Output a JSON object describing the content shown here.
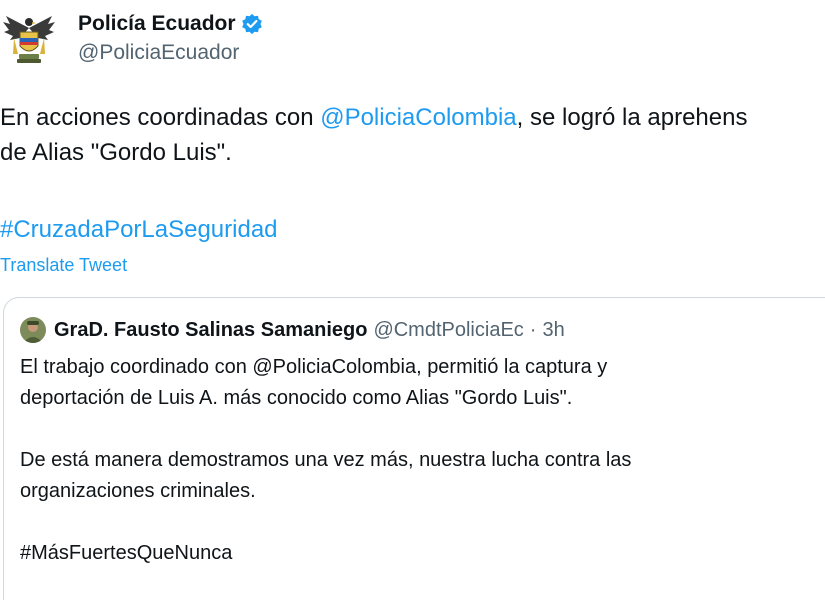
{
  "author": {
    "display_name": "Policía Ecuador",
    "handle": "@PoliciaEcuador",
    "verified_icon": "verified-badge-icon",
    "avatar_icon": "police-eagle-emblem"
  },
  "tweet": {
    "line1_prefix": "En acciones coordinadas con ",
    "line1_mention": "@PoliciaColombia",
    "line1_suffix": ", se logró la aprehens",
    "line2": "de Alias \"Gordo Luis\".",
    "hashtag": "#CruzadaPorLaSeguridad",
    "translate_label": "Translate Tweet"
  },
  "quoted": {
    "name": "GraD. Fausto Salinas Samaniego",
    "handle": "@CmdtPoliciaEc",
    "separator": "·",
    "time": "3h",
    "lines": [
      "El trabajo coordinado con @PoliciaColombia, permitió la captura y",
      "deportación de Luis A. más conocido como Alias \"Gordo Luis\".",
      "De está manera demostramos una vez más, nuestra lucha contra las",
      "organizaciones criminales.",
      "#MásFuertesQueNunca"
    ]
  },
  "colors": {
    "link": "#1d9bf0",
    "text": "#0f1419",
    "secondary": "#536471",
    "border": "#cfd9de"
  }
}
